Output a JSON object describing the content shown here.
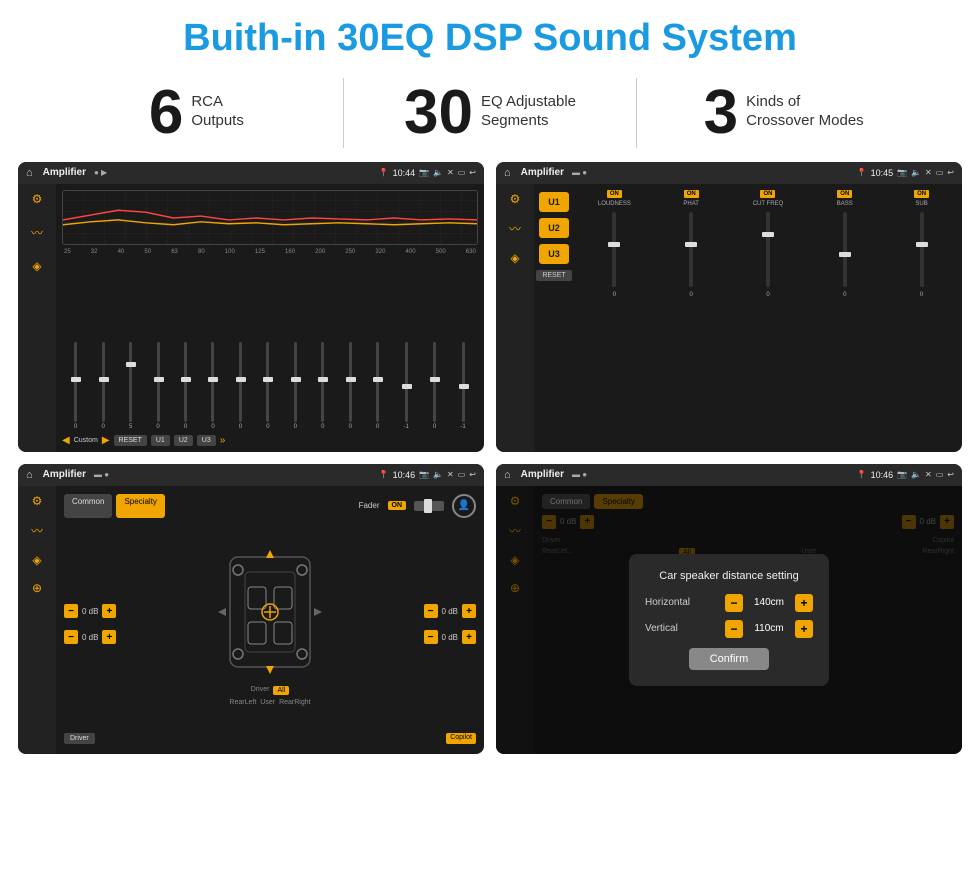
{
  "page": {
    "title": "Buith-in 30EQ DSP Sound System"
  },
  "stats": [
    {
      "number": "6",
      "line1": "RCA",
      "line2": "Outputs"
    },
    {
      "number": "30",
      "line1": "EQ Adjustable",
      "line2": "Segments"
    },
    {
      "number": "3",
      "line1": "Kinds of",
      "line2": "Crossover Modes"
    }
  ],
  "screens": [
    {
      "id": "screen1",
      "status": {
        "title": "Amplifier",
        "time": "10:44"
      },
      "type": "eq",
      "eq_labels": [
        "25",
        "32",
        "40",
        "50",
        "63",
        "80",
        "100",
        "125",
        "160",
        "200",
        "250",
        "320",
        "400",
        "500",
        "630"
      ],
      "preset_label": "Custom",
      "buttons": [
        "RESET",
        "U1",
        "U2",
        "U3"
      ]
    },
    {
      "id": "screen2",
      "status": {
        "title": "Amplifier",
        "time": "10:45"
      },
      "type": "mixer",
      "presets": [
        "U1",
        "U2",
        "U3"
      ],
      "channels": [
        {
          "label": "LOUDNESS",
          "on": true
        },
        {
          "label": "PHAT",
          "on": true
        },
        {
          "label": "CUT FREQ",
          "on": true
        },
        {
          "label": "BASS",
          "on": true
        },
        {
          "label": "SUB",
          "on": true
        }
      ],
      "reset_btn": "RESET"
    },
    {
      "id": "screen3",
      "status": {
        "title": "Amplifier",
        "time": "10:46"
      },
      "type": "fader",
      "tabs": [
        "Common",
        "Specialty"
      ],
      "fader_label": "Fader",
      "on_label": "ON",
      "zones": {
        "driver": "Driver",
        "copilot": "Copilot",
        "rear_left": "RearLeft",
        "all": "All",
        "user": "User",
        "rear_right": "RearRight"
      },
      "db_values": [
        "0 dB",
        "0 dB",
        "0 dB",
        "0 dB"
      ]
    },
    {
      "id": "screen4",
      "status": {
        "title": "Amplifier",
        "time": "10:46"
      },
      "type": "dialog",
      "tabs": [
        "Common",
        "Specialty"
      ],
      "dialog": {
        "title": "Car speaker distance setting",
        "horizontal_label": "Horizontal",
        "horizontal_value": "140cm",
        "vertical_label": "Vertical",
        "vertical_value": "110cm",
        "confirm_btn": "Confirm"
      },
      "zones": {
        "driver": "Driver",
        "copilot": "Copilot",
        "rear_left": "RearLef...",
        "all": "All",
        "user": "User",
        "rear_right": "RearRight"
      },
      "db_values": [
        "0 dB",
        "0 dB"
      ]
    }
  ]
}
